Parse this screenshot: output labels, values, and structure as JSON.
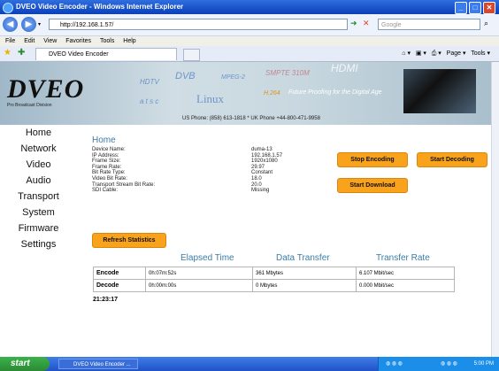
{
  "window": {
    "title": "DVEO Video Encoder - Windows Internet Explorer"
  },
  "browser": {
    "url": "http://192.168.1.57/",
    "search_placeholder": "Google",
    "menu": [
      "File",
      "Edit",
      "View",
      "Favorites",
      "Tools",
      "Help"
    ],
    "tab_title": "DVEO Video Encoder",
    "toolbar_right": {
      "page": "Page",
      "tools": "Tools"
    }
  },
  "banner": {
    "logo": "DVEO",
    "logo_sub": "Pro Broadcast Division",
    "buzzwords": [
      "HDTV",
      "DVB",
      "MPEG-2",
      "SMPTE 310M",
      "HDMI",
      "a t s c",
      "Linux",
      "H.264"
    ],
    "tagline": "Future Proofing for the Digital Age",
    "phone": "US Phone: (858) 613-1818  *  UK Phone +44-800-471-9958"
  },
  "nav": [
    "Home",
    "Network",
    "Video",
    "Audio",
    "Transport",
    "System",
    "Firmware",
    "Settings"
  ],
  "page": {
    "title": "Home",
    "info": [
      {
        "label": "Device Name:",
        "value": "duma-13"
      },
      {
        "label": "IP Address:",
        "value": "192.168.1.57"
      },
      {
        "label": "Frame Size:",
        "value": "1920x1080"
      },
      {
        "label": "Frame Rate:",
        "value": "29.97"
      },
      {
        "label": "Bit Rate Type:",
        "value": "Constant"
      },
      {
        "label": "Video Bit Rate:",
        "value": "18.0"
      },
      {
        "label": "Transport Stream Bit Rate:",
        "value": "20.0"
      },
      {
        "label": "SDI Cable:",
        "value": "Missing"
      }
    ],
    "buttons": {
      "stop_encoding": "Stop Encoding",
      "start_decoding": "Start Decoding",
      "start_download": "Start Download",
      "refresh": "Refresh Statistics"
    },
    "stats": {
      "headers": [
        "Elapsed Time",
        "Data Transfer",
        "Transfer Rate"
      ],
      "rows": [
        {
          "name": "Encode",
          "elapsed": "0h:07m:52s",
          "data": "361 Mbytes",
          "rate": "6.107 Mbit/sec"
        },
        {
          "name": "Decode",
          "elapsed": "0h:00m:00s",
          "data": "0 Mbytes",
          "rate": "0.000 Mbit/sec"
        }
      ]
    },
    "timestamp": "21:23:17"
  },
  "taskbar": {
    "start": "start",
    "item": "DVEO Video Encoder ...",
    "clock": "5:00 PM"
  }
}
